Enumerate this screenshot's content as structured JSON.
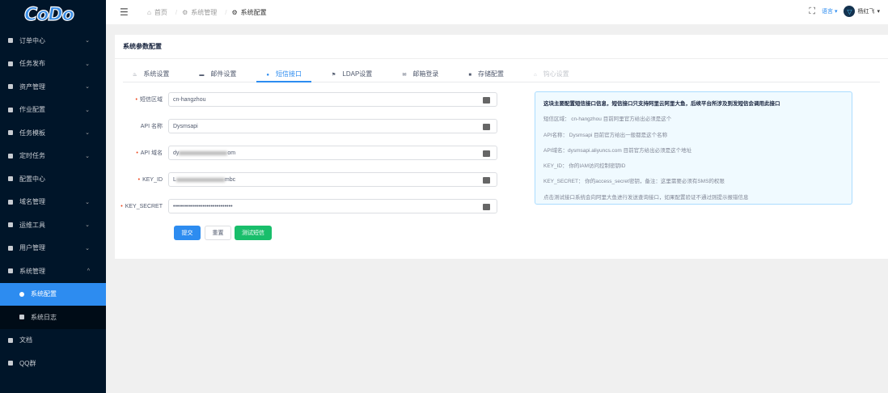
{
  "logo": "CoDo",
  "sidebar": {
    "items": [
      {
        "label": "订单中心",
        "expand": "⌄"
      },
      {
        "label": "任务发布",
        "expand": "⌄"
      },
      {
        "label": "资产管理",
        "expand": "⌄"
      },
      {
        "label": "作业配置",
        "expand": "⌄"
      },
      {
        "label": "任务模板",
        "expand": "⌄"
      },
      {
        "label": "定时任务",
        "expand": "⌄"
      },
      {
        "label": "配置中心"
      },
      {
        "label": "域名管理",
        "expand": "⌄"
      },
      {
        "label": "运维工具",
        "expand": "⌄"
      },
      {
        "label": "用户管理",
        "expand": "⌄"
      },
      {
        "label": "系统管理",
        "expand": "^"
      }
    ],
    "sub": [
      {
        "label": "系统配置"
      },
      {
        "label": "系统日志"
      }
    ],
    "bottom": [
      {
        "label": "文档"
      },
      {
        "label": "QQ群"
      }
    ]
  },
  "header": {
    "breadcrumb": [
      "首页",
      "系统管理",
      "系统配置"
    ],
    "language": "语言",
    "user": "杨红飞"
  },
  "card": {
    "title": "系统参数配置",
    "tabs": [
      "系统设置",
      "邮件设置",
      "短信接口",
      "LDAP设置",
      "邮箱登录",
      "存储配置",
      "钩心设置"
    ],
    "fields": [
      {
        "label": "短信区域",
        "required": "•",
        "value": "cn-hangzhou"
      },
      {
        "label": "API 名称",
        "required": "",
        "value": "Dysmsapi"
      },
      {
        "label": "API 域名",
        "required": "•",
        "value": "dy",
        "value_end": "om"
      },
      {
        "label": "KEY_ID",
        "required": "•",
        "value": "L",
        "value_end": "mbc"
      },
      {
        "label": "KEY_SECRET",
        "required": "•",
        "value": "••••••••••••••••••••••••••••••"
      }
    ],
    "buttons": {
      "submit": "提交",
      "reset": "重置",
      "test": "测试短信"
    },
    "info": [
      "这块主要配置短信接口信息，短信接口只支持阿里云阿里大鱼，后续平台所涉及到发短信会调用此接口",
      "短信区域： cn-hangzhou 目前阿里官方给出必须是这个",
      "API名称： Dysmsapi 目前官方给出一般都是这个名称",
      "API域名：dysmsapi.aliyuncs.com 目前官方给出必须是这个地址",
      "KEY_ID： 你的IAM访问控制密钥ID",
      "KEY_SECRET： 你的access_secret密钥，备注：这里需要必须有SMS的权限",
      "点击测试接口系统会向阿里大鱼进行发送查询接口，如果配置验证不通过则提示报错信息"
    ]
  },
  "colors": {
    "primary": "#2d8cf0",
    "success": "#19be6b",
    "sidebar": "#001529"
  }
}
